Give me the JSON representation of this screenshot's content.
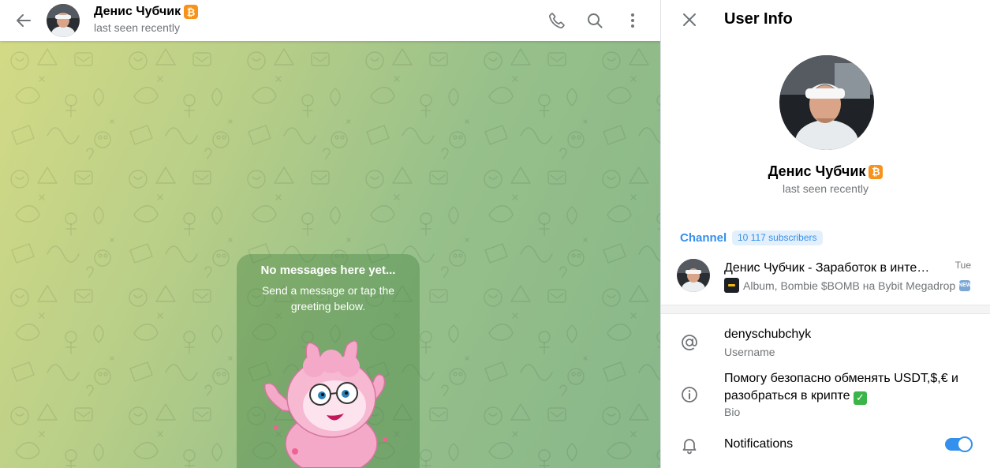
{
  "chat_header": {
    "peer_name": "Денис Чубчик",
    "peer_status": "last seen recently",
    "badge_symbol": "₿"
  },
  "empty_state": {
    "title": "No messages here yet...",
    "text": "Send a message or tap the greeting below."
  },
  "user_info": {
    "title": "User Info",
    "name": "Денис Чубчик",
    "status": "last seen recently",
    "channel": {
      "label": "Channel",
      "subscribers": "10 117 subscribers",
      "title": "Денис Чубчик - Заработок в инте…",
      "time": "Tue",
      "last_message": "Album, Bombie $BOMB на Bybit Megadrop"
    },
    "username": {
      "value": "denyschubchyk",
      "label": "Username"
    },
    "bio": {
      "line1": "Помогу безопасно обменять USDT,$,€ и",
      "line2": "разобраться в крипте",
      "label": "Bio"
    },
    "notifications": {
      "label": "Notifications",
      "enabled": true
    }
  },
  "icons": {
    "back": "arrow-left-icon",
    "call": "phone-icon",
    "search": "search-icon",
    "more": "more-vertical-icon",
    "close": "close-icon",
    "username": "at-sign-icon",
    "bio": "info-icon",
    "notifications": "bell-icon"
  },
  "colors": {
    "accent": "#3390ec",
    "badge": "#f7931a",
    "secondary_text": "#707579",
    "wallpaper_start": "#d3da86",
    "wallpaper_end": "#88b78a"
  }
}
